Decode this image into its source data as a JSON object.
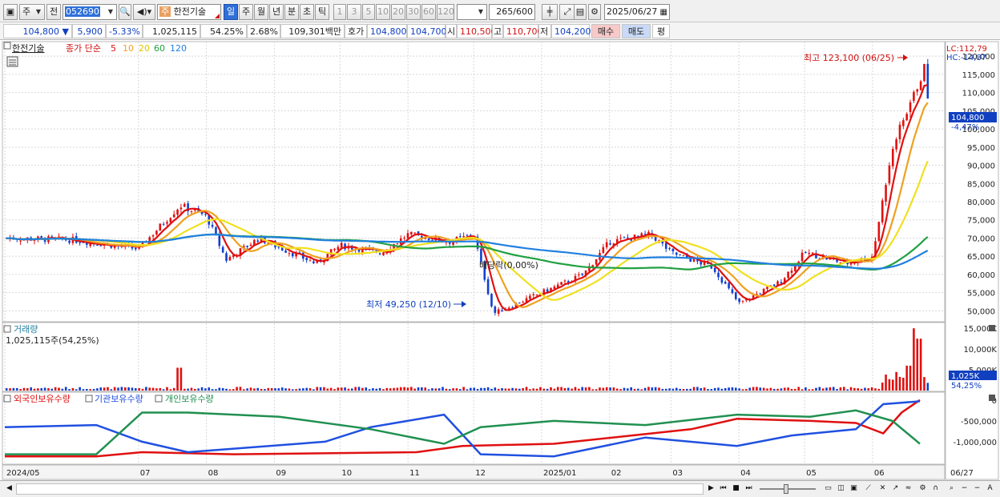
{
  "toolbar": {
    "mode_label": "주",
    "prev_label": "전",
    "code_value": "052690",
    "name_badge": "주",
    "name_value": "한전기술",
    "periods": [
      "일",
      "주",
      "월",
      "년",
      "분",
      "초",
      "틱"
    ],
    "active_period": "일",
    "numbers": [
      "1",
      "3",
      "5",
      "10",
      "20",
      "30",
      "60",
      "120"
    ],
    "count_current": "265",
    "count_total": "600",
    "date_value": "2025/06/27"
  },
  "quote": {
    "price": "104,800",
    "arrow": "▼",
    "change": "5,900",
    "change_pct": "-5.33%",
    "volume": "1,025,115",
    "vol_ratio": "54.25%",
    "turnover": "2.68%",
    "amount": "109,301백만",
    "bid_ask_label": "호가",
    "ask": "104,800",
    "bid": "104,700",
    "open_label": "시",
    "open": "110,500",
    "high_label": "고",
    "high": "110,700",
    "low_label": "저",
    "low": "104,200",
    "buy_label": "매수",
    "sell_label": "매도",
    "avg_label": "평"
  },
  "legend": {
    "name": "한전기술",
    "desc": "종가 단순",
    "ma": [
      {
        "label": "5",
        "color": "#e01010"
      },
      {
        "label": "10",
        "color": "#f0a020"
      },
      {
        "label": "20",
        "color": "#f0e020"
      },
      {
        "label": "60",
        "color": "#20a040"
      },
      {
        "label": "120",
        "color": "#2080e0"
      }
    ]
  },
  "annotations": {
    "lc": "LC:112,79",
    "hc": "HC:-14,87",
    "high_marker": "최고 123,100 (06/25)",
    "low_marker": "최저 49,250 (12/10)",
    "dividend": "배당락(0,00%)",
    "last_price": "104,800",
    "last_pct": "-4,47%"
  },
  "price_axis": [
    "120,000",
    "115,000",
    "110,000",
    "105,000",
    "100,000",
    "95,000",
    "90,000",
    "85,000",
    "80,000",
    "75,000",
    "70,000",
    "65,000",
    "60,000",
    "55,000",
    "50,000"
  ],
  "volume_panel": {
    "title": "거래량",
    "value": "1,025,115주(54,25%)",
    "axis": [
      "15,000K",
      "10,000K",
      "5,000K"
    ],
    "last": "1,025K",
    "last_pct": "54,25%"
  },
  "holdings_panel": {
    "series": [
      {
        "name": "외국인보유수량",
        "color": "#e01010"
      },
      {
        "name": "기관보유수량",
        "color": "#2050e0"
      },
      {
        "name": "개인보유수량",
        "color": "#209050"
      }
    ],
    "axis": [
      "0",
      "-500,000",
      "-1,000,000"
    ]
  },
  "x_axis": [
    "2024/05",
    "07",
    "08",
    "09",
    "10",
    "11",
    "12",
    "2025/01",
    "02",
    "03",
    "04",
    "05",
    "06",
    "06/27"
  ],
  "colors": {
    "up": "#e01010",
    "down": "#1040d0",
    "grid": "#d8d8d8"
  },
  "chart_data": {
    "type": "candlestick",
    "x_start": "2024/05",
    "x_end": "2025/06/27",
    "price_ylim": [
      47000,
      124000
    ],
    "high": {
      "value": 123100,
      "date": "06/25"
    },
    "low": {
      "value": 49250,
      "date": "12/10"
    },
    "close_path": [
      [
        "2024/05",
        70000
      ],
      [
        "2024/06",
        69500
      ],
      [
        "2024/07",
        67000
      ],
      [
        "2024/07/20",
        79000
      ],
      [
        "2024/08",
        76000
      ],
      [
        "2024/08/10",
        64000
      ],
      [
        "2024/08/25",
        70000
      ],
      [
        "2024/09",
        68000
      ],
      [
        "2024/09/20",
        63000
      ],
      [
        "2024/10",
        68000
      ],
      [
        "2024/10/20",
        66000
      ],
      [
        "2024/11",
        71000
      ],
      [
        "2024/11/20",
        69000
      ],
      [
        "2024/12",
        71000
      ],
      [
        "2024/12/10",
        49250
      ],
      [
        "2025/01",
        55000
      ],
      [
        "2025/01/20",
        60000
      ],
      [
        "2025/02",
        69000
      ],
      [
        "2025/02/20",
        71000
      ],
      [
        "2025/03",
        66000
      ],
      [
        "2025/03/20",
        62000
      ],
      [
        "2025/04",
        52000
      ],
      [
        "2025/04/20",
        58000
      ],
      [
        "2025/05",
        66000
      ],
      [
        "2025/05/20",
        63000
      ],
      [
        "2025/06",
        65000
      ],
      [
        "2025/06/10",
        95000
      ],
      [
        "2025/06/25",
        117000
      ],
      [
        "2025/06/27",
        104800
      ]
    ],
    "volume_ylim": [
      0,
      16000000
    ],
    "volume_peaks": [
      [
        "2025/06/20",
        15000000
      ],
      [
        "2025/06/22",
        12500000
      ],
      [
        "2025/06/18",
        6000000
      ],
      [
        "2024/07/20",
        5500000
      ]
    ],
    "holdings_ylim": [
      -1500000,
      150000
    ]
  }
}
